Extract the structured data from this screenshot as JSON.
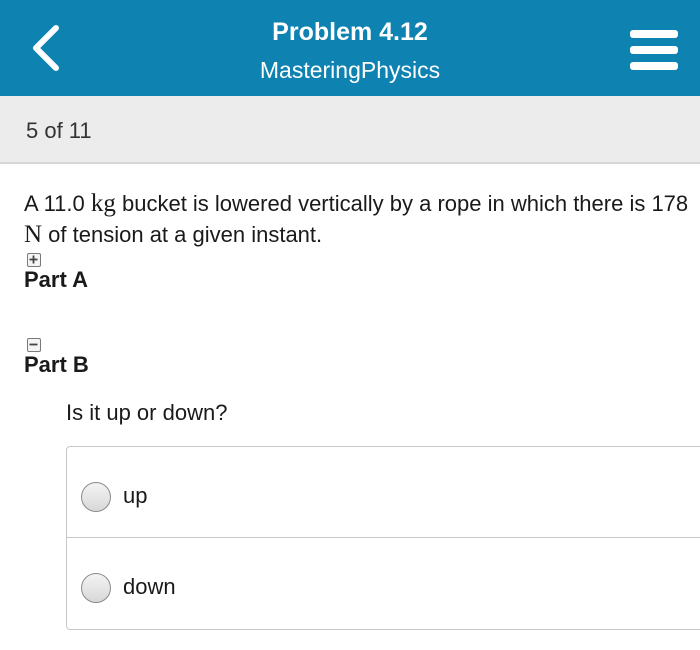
{
  "header": {
    "title": "Problem 4.12",
    "subtitle": "MasteringPhysics",
    "back_icon": "chevron-left-icon",
    "menu_icon": "menu-icon",
    "background_color": "#0e82b0"
  },
  "progress": {
    "text": "5 of 11"
  },
  "problem": {
    "text_1": "A 11.0 ",
    "unit_1": "kg",
    "text_2": " bucket is lowered vertically by a rope in which there is 178 ",
    "unit_2": "N",
    "text_3": " of tension at a given instant."
  },
  "parts": [
    {
      "label": "Part A",
      "toggle": "+",
      "expanded": false
    },
    {
      "label": "Part B",
      "toggle": "-",
      "expanded": true
    }
  ],
  "part_b": {
    "question": "Is it up or down?",
    "options": [
      {
        "label": "up",
        "selected": false
      },
      {
        "label": "down",
        "selected": false
      }
    ]
  }
}
